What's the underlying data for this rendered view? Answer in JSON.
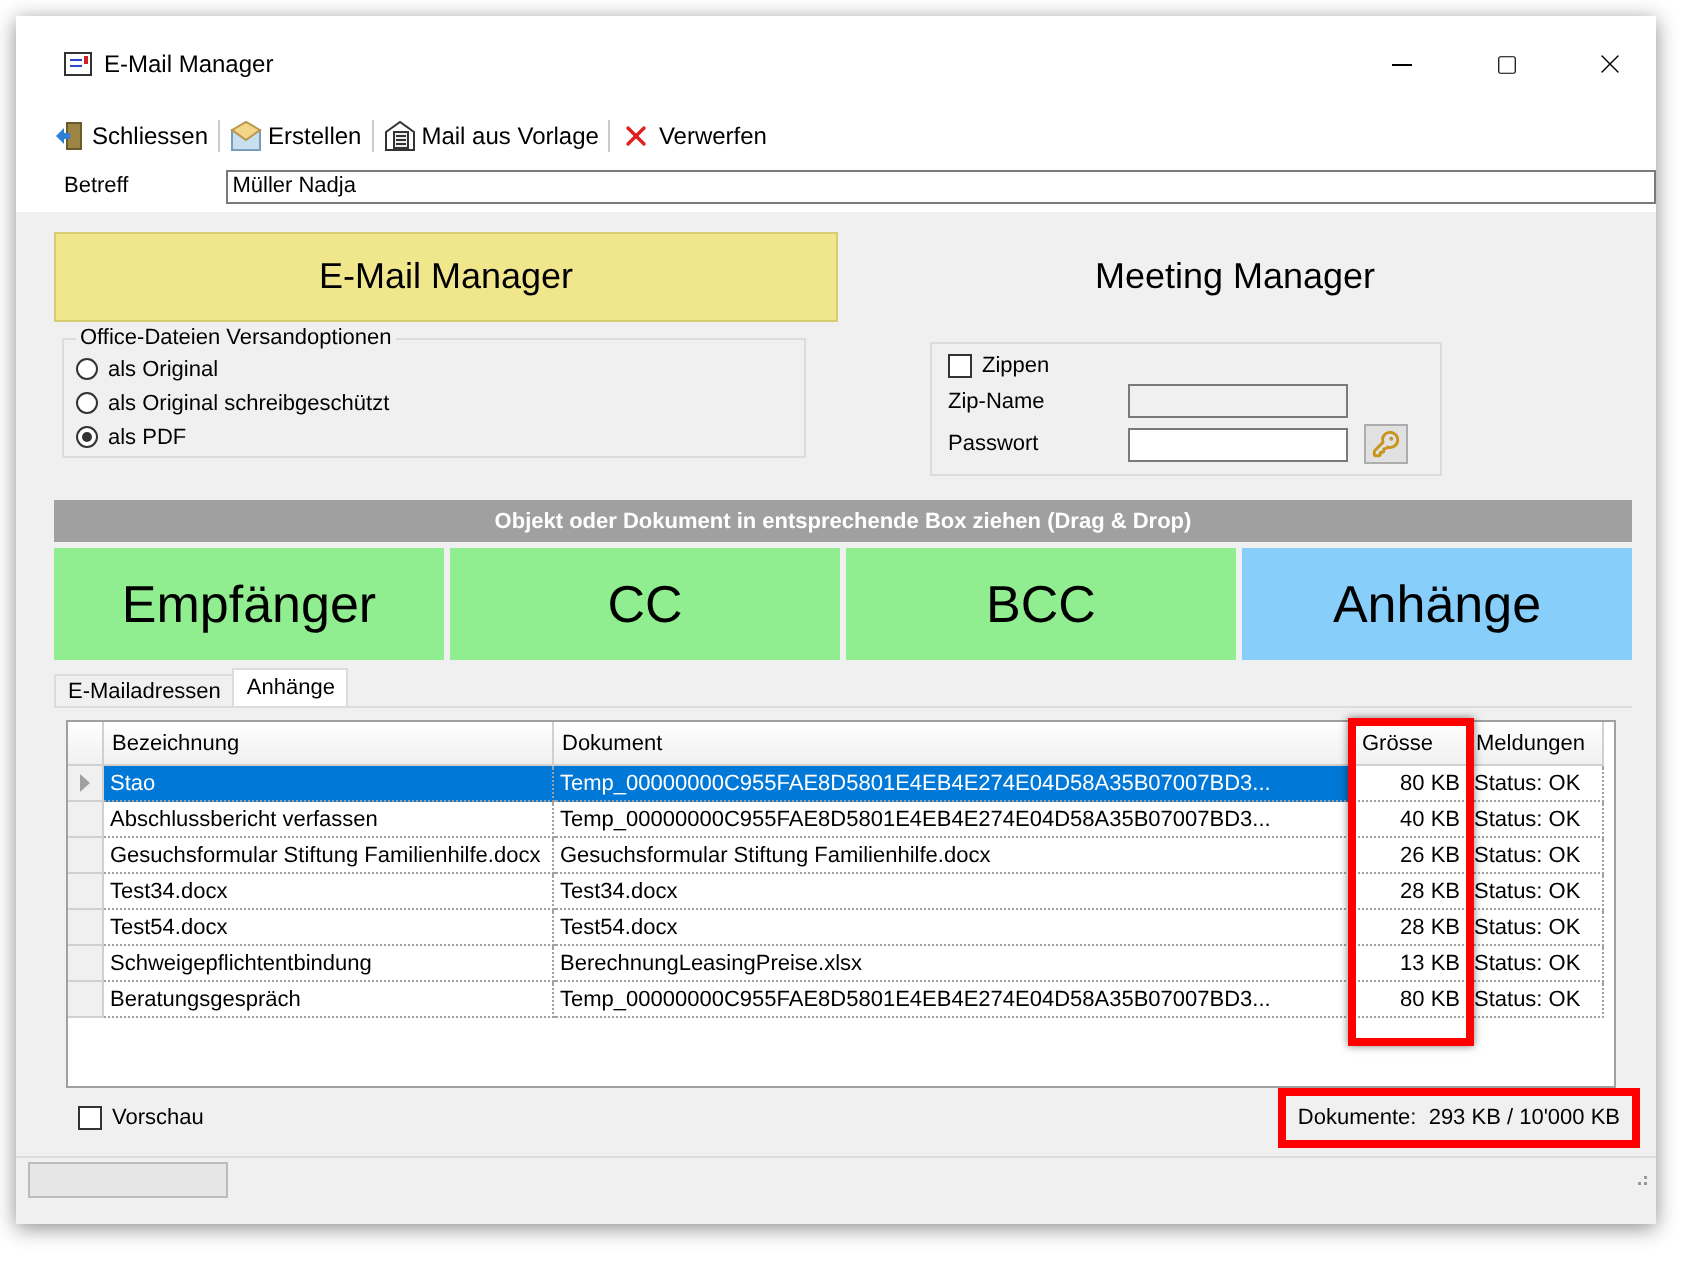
{
  "window": {
    "title": "E-Mail Manager"
  },
  "toolbar": [
    {
      "label": "Schliessen",
      "kind": "door"
    },
    {
      "label": "Erstellen",
      "kind": "envelope"
    },
    {
      "label": "Mail aus Vorlage",
      "kind": "template"
    },
    {
      "label": "Verwerfen",
      "kind": "discard"
    }
  ],
  "subject": {
    "label": "Betreff",
    "value": "Müller Nadja"
  },
  "managers": [
    {
      "label": "E-Mail Manager",
      "selected": true
    },
    {
      "label": "Meeting Manager",
      "selected": false
    }
  ],
  "office_options": {
    "title": "Office-Dateien Versandoptionen",
    "options": [
      {
        "label": "als Original",
        "selected": false
      },
      {
        "label": "als Original schreibgeschützt",
        "selected": false
      },
      {
        "label": "als PDF",
        "selected": true
      }
    ]
  },
  "zip": {
    "label": "Zippen",
    "checked": false,
    "name_label": "Zip-Name",
    "password_label": "Passwort"
  },
  "drop_hint": "Objekt oder Dokument in entsprechende Box ziehen (Drag & Drop)",
  "drop_zones": [
    {
      "label": "Empfänger",
      "color": "#90ee90"
    },
    {
      "label": "CC",
      "color": "#90ee90"
    },
    {
      "label": "BCC",
      "color": "#90ee90"
    },
    {
      "label": "Anhänge",
      "color": "#87cefa"
    }
  ],
  "tabs": [
    {
      "label": "E-Mailadressen",
      "selected": false
    },
    {
      "label": "Anhänge",
      "selected": true
    }
  ],
  "table": {
    "columns": [
      "Bezeichnung",
      "Dokument",
      "Grösse",
      "Meldungen"
    ],
    "size_column_highlighted": true,
    "rows": [
      {
        "cells": [
          "Stao",
          "Temp_00000000C955FAE8D5801E4EB4E274E04D58A35B07007BD3...",
          "80 KB",
          "Status: OK"
        ],
        "selected": true
      },
      {
        "cells": [
          "Abschlussbericht verfassen",
          "Temp_00000000C955FAE8D5801E4EB4E274E04D58A35B07007BD3...",
          "40 KB",
          "Status: OK"
        ],
        "selected": false
      },
      {
        "cells": [
          "Gesuchsformular Stiftung Familienhilfe.docx",
          "Gesuchsformular Stiftung Familienhilfe.docx",
          "26 KB",
          "Status: OK"
        ],
        "selected": false
      },
      {
        "cells": [
          "Test34.docx",
          "Test34.docx",
          "28 KB",
          "Status: OK"
        ],
        "selected": false
      },
      {
        "cells": [
          "Test54.docx",
          "Test54.docx",
          "28 KB",
          "Status: OK"
        ],
        "selected": false
      },
      {
        "cells": [
          "Schweigepflichtentbindung",
          "BerechnungLeasingPreise.xlsx",
          "13 KB",
          "Status: OK"
        ],
        "selected": false
      },
      {
        "cells": [
          "Beratungsgespräch",
          "Temp_00000000C955FAE8D5801E4EB4E274E04D58A35B07007BD3...",
          "80 KB",
          "Status: OK"
        ],
        "selected": false
      }
    ]
  },
  "status_progress": {
    "level": 0
  },
  "preview": {
    "label": "Vorschau",
    "checked": false
  },
  "total": {
    "text": "Dokumente:  293 KB / 10'000 KB",
    "highlighted": true
  }
}
